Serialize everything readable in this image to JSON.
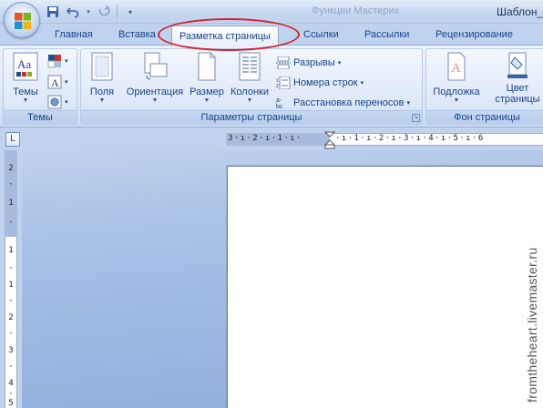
{
  "titlebar": {
    "ghost_title": "Функции Мастерих",
    "title": "Шаблон_"
  },
  "tabs": [
    {
      "label": "Главная"
    },
    {
      "label": "Вставка"
    },
    {
      "label": "Разметка страницы",
      "active": true
    },
    {
      "label": "Ссылки"
    },
    {
      "label": "Рассылки"
    },
    {
      "label": "Рецензирование"
    }
  ],
  "ribbon": {
    "themes_group": {
      "label": "Темы",
      "themes_button": "Темы"
    },
    "page_setup_group": {
      "label": "Параметры страницы",
      "margins": "Поля",
      "orientation": "Ориентация",
      "size": "Размер",
      "columns": "Колонки",
      "breaks": "Разрывы",
      "line_numbers": "Номера строк",
      "hyphenation": "Расстановка переносов"
    },
    "background_group": {
      "label": "Фон страницы",
      "watermark": "Подложка",
      "page_color_line1": "Цвет",
      "page_color_line2": "страницы"
    }
  },
  "rulers": {
    "horizontal": "3·ı·2·ı·1·ı·",
    "horizontal_right": "·ı·1·ı·2·ı·3·ı·4·ı·5·ı·6",
    "vertical": [
      "2",
      "·",
      "1",
      "·",
      "1",
      "·",
      "1",
      "·",
      "2",
      "·",
      "3",
      "·",
      "4",
      "·",
      "5"
    ]
  },
  "watermark_text": "fromtheheart.livemaster.ru",
  "colors": {
    "accent": "#15428b",
    "highlight_circle": "#d5212e",
    "ribbon_bg": "#dbe7f7",
    "workspace_bg": "#a9c1e6"
  }
}
